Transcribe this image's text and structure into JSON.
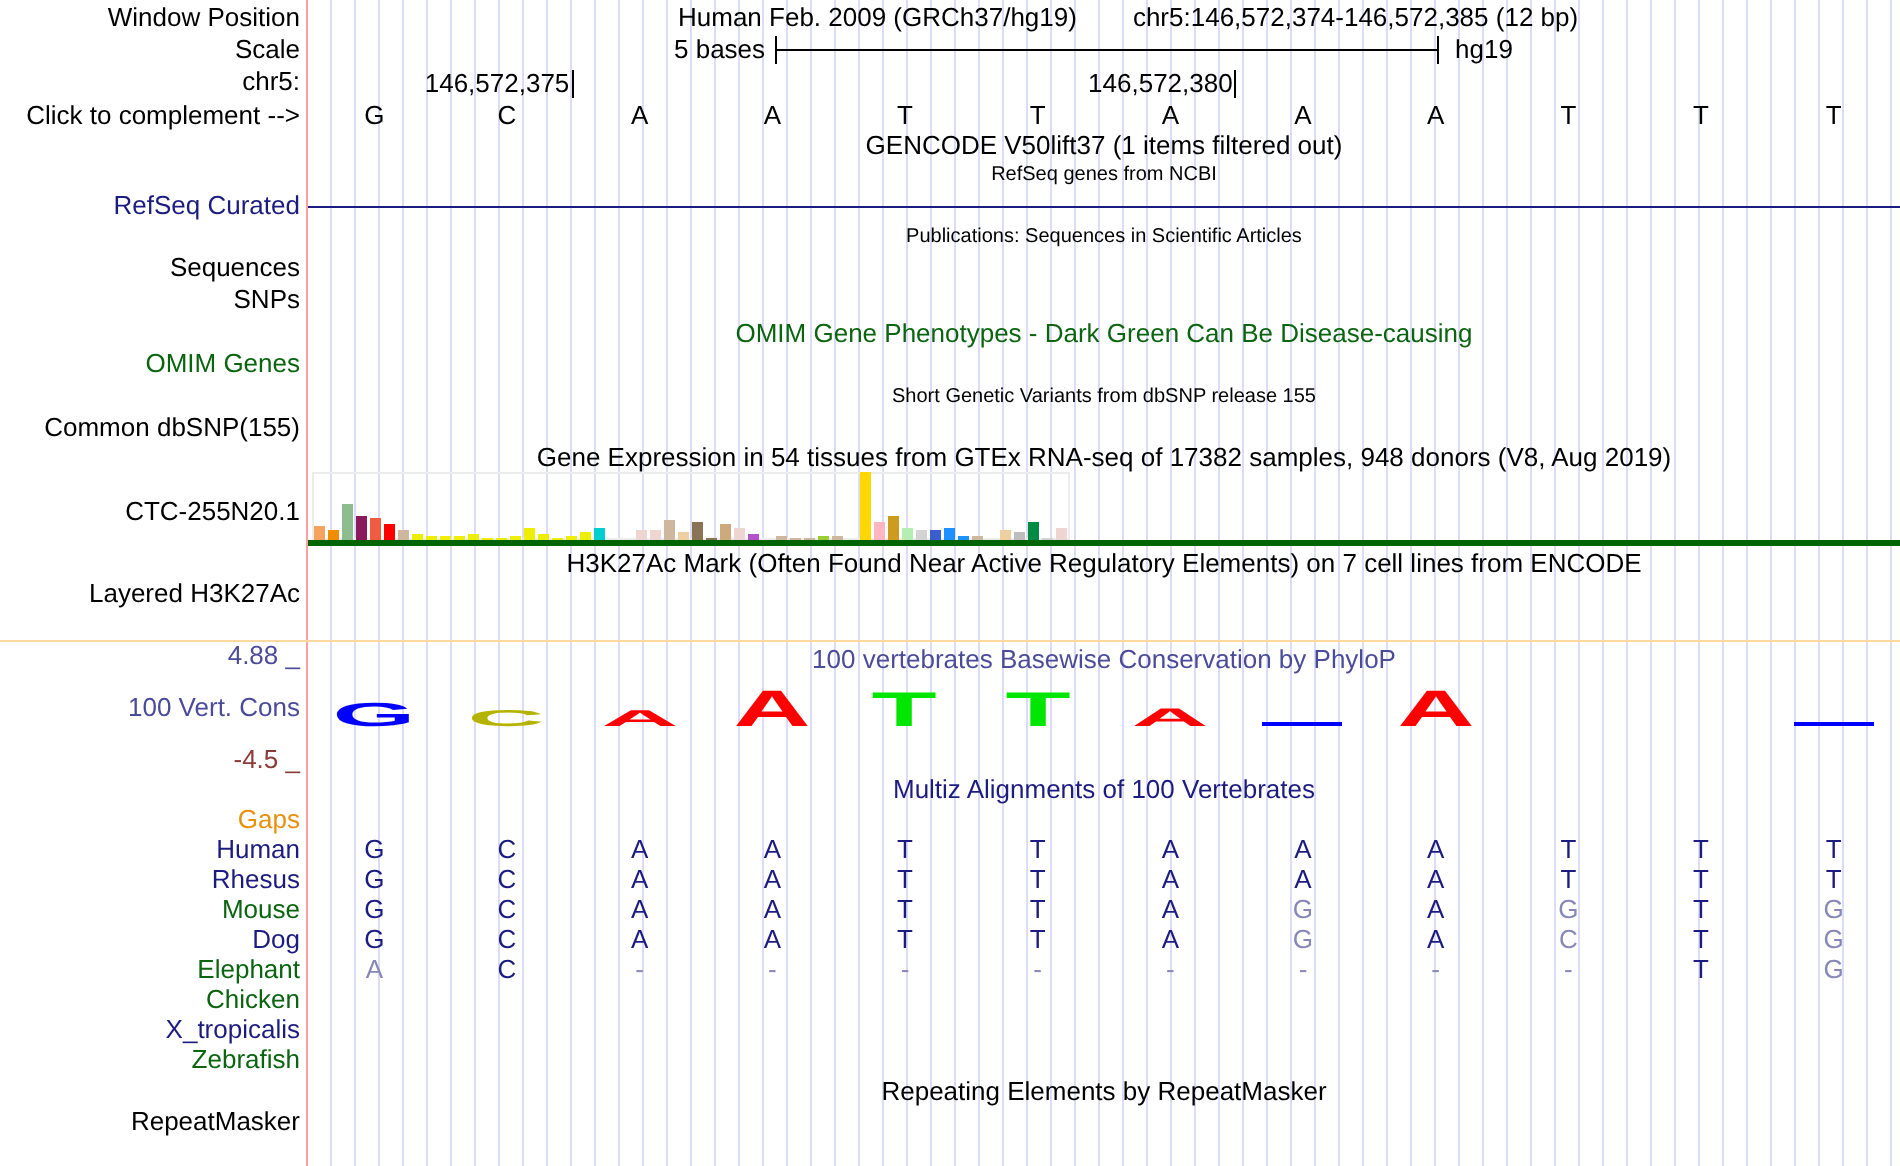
{
  "header": {
    "window_position_label": "Window Position",
    "assembly": "Human Feb. 2009 (GRCh37/hg19)",
    "position": "chr5:146,572,374-146,572,385 (12 bp)",
    "scale_label": "Scale",
    "scale_text": "5 bases",
    "scale_db": "hg19",
    "chrom_label": "chr5:",
    "complement_label": "Click to complement -->"
  },
  "bases": [
    {
      "base": "G"
    },
    {
      "base": "C",
      "tick": "146,572,375"
    },
    {
      "base": "A"
    },
    {
      "base": "A"
    },
    {
      "base": "T"
    },
    {
      "base": "T"
    },
    {
      "base": "A",
      "tick": "146,572,380"
    },
    {
      "base": "A"
    },
    {
      "base": "A"
    },
    {
      "base": "T"
    },
    {
      "base": "T"
    },
    {
      "base": "T"
    }
  ],
  "tracks": [
    {
      "kind": "title",
      "title": "GENCODE V50lift37 (1 items filtered out)"
    },
    {
      "kind": "line",
      "title": "RefSeq genes from NCBI",
      "labels": [
        "RefSeq Curated"
      ],
      "color": "#1c1c80"
    },
    {
      "kind": "note",
      "title": "Publications: Sequences in Scientific Articles",
      "labels": [
        "Sequences",
        "SNPs"
      ]
    },
    {
      "kind": "text",
      "title": "OMIM Gene Phenotypes - Dark Green Can Be Disease-causing",
      "labels": [
        "OMIM Genes"
      ],
      "color": "#0b6410"
    },
    {
      "kind": "note",
      "title": "Short Genetic Variants from dbSNP release 155",
      "labels": [
        "Common dbSNP(155)"
      ]
    },
    {
      "kind": "expression",
      "title": "Gene Expression in 54 tissues from GTEx RNA-seq of 17382 samples, 948 donors (V8, Aug 2019)",
      "labels": [
        "CTC-255N20.1"
      ]
    },
    {
      "kind": "signal",
      "title": "H3K27Ac Mark (Often Found Near Active Regulatory Elements) on 7 cell lines from ENCODE",
      "labels": [
        "Layered H3K27Ac"
      ]
    },
    {
      "kind": "conservation",
      "title": "100 vertebrates Basewise Conservation by PhyloP",
      "labels": [
        "100 Vert. Cons"
      ],
      "color": "#4b4b9a",
      "max": "4.88 _",
      "min": "-4.5 _",
      "logo": [
        {
          "kind": "letter",
          "letter": "G",
          "color": "#0000ff"
        },
        {
          "kind": "letter",
          "letter": "C",
          "color": "#b4b400"
        },
        {
          "kind": "letter",
          "letter": "A",
          "color": "#ff0000"
        },
        {
          "kind": "letter",
          "letter": "A",
          "color": "#ff0000"
        },
        {
          "kind": "letter",
          "letter": "T",
          "color": "#00e600"
        },
        {
          "kind": "letter",
          "letter": "T",
          "color": "#00e600"
        },
        {
          "kind": "letter",
          "letter": "A",
          "color": "#ff0000"
        },
        {
          "kind": "dash",
          "color": "#0000ff"
        },
        {
          "kind": "letter",
          "letter": "A",
          "color": "#ff0000"
        },
        {
          "kind": "blank"
        },
        {
          "kind": "blank"
        },
        {
          "kind": "dash",
          "color": "#0000ff"
        }
      ]
    },
    {
      "kind": "alignment",
      "title": "Multiz Alignments of 100 Vertebrates",
      "color": "#1c1c80",
      "gaps_label": "Gaps",
      "species": [
        {
          "name": "Human",
          "color": "#1c1c80",
          "cells": [
            {
              "base": "G",
              "match": true
            },
            {
              "base": "C",
              "match": true
            },
            {
              "base": "A",
              "match": true
            },
            {
              "base": "A",
              "match": true
            },
            {
              "base": "T",
              "match": true
            },
            {
              "base": "T",
              "match": true
            },
            {
              "base": "A",
              "match": true
            },
            {
              "base": "A",
              "match": true
            },
            {
              "base": "A",
              "match": true
            },
            {
              "base": "T",
              "match": true
            },
            {
              "base": "T",
              "match": true
            },
            {
              "base": "T",
              "match": true
            }
          ]
        },
        {
          "name": "Rhesus",
          "color": "#1c1c80",
          "cells": [
            {
              "base": "G",
              "match": true
            },
            {
              "base": "C",
              "match": true
            },
            {
              "base": "A",
              "match": true
            },
            {
              "base": "A",
              "match": true
            },
            {
              "base": "T",
              "match": true
            },
            {
              "base": "T",
              "match": true
            },
            {
              "base": "A",
              "match": true
            },
            {
              "base": "A",
              "match": true
            },
            {
              "base": "A",
              "match": true
            },
            {
              "base": "T",
              "match": true
            },
            {
              "base": "T",
              "match": true
            },
            {
              "base": "T",
              "match": true
            }
          ]
        },
        {
          "name": "Mouse",
          "color": "#0b6410",
          "cells": [
            {
              "base": "G",
              "match": true
            },
            {
              "base": "C",
              "match": true
            },
            {
              "base": "A",
              "match": true
            },
            {
              "base": "A",
              "match": true
            },
            {
              "base": "T",
              "match": true
            },
            {
              "base": "T",
              "match": true
            },
            {
              "base": "A",
              "match": true
            },
            {
              "base": "G",
              "match": false
            },
            {
              "base": "A",
              "match": true
            },
            {
              "base": "G",
              "match": false
            },
            {
              "base": "T",
              "match": true
            },
            {
              "base": "G",
              "match": false
            }
          ]
        },
        {
          "name": "Dog",
          "color": "#1c1c80",
          "cells": [
            {
              "base": "G",
              "match": true
            },
            {
              "base": "C",
              "match": true
            },
            {
              "base": "A",
              "match": true
            },
            {
              "base": "A",
              "match": true
            },
            {
              "base": "T",
              "match": true
            },
            {
              "base": "T",
              "match": true
            },
            {
              "base": "A",
              "match": true
            },
            {
              "base": "G",
              "match": false
            },
            {
              "base": "A",
              "match": true
            },
            {
              "base": "C",
              "match": false
            },
            {
              "base": "T",
              "match": true
            },
            {
              "base": "G",
              "match": false
            }
          ]
        },
        {
          "name": "Elephant",
          "color": "#0b6410",
          "cells": [
            {
              "base": "A",
              "match": false
            },
            {
              "base": "C",
              "match": true
            },
            {
              "base": "-",
              "match": false
            },
            {
              "base": "-",
              "match": false
            },
            {
              "base": "-",
              "match": false
            },
            {
              "base": "-",
              "match": false
            },
            {
              "base": "-",
              "match": false
            },
            {
              "base": "-",
              "match": false
            },
            {
              "base": "-",
              "match": false
            },
            {
              "base": "-",
              "match": false
            },
            {
              "base": "T",
              "match": true
            },
            {
              "base": "G",
              "match": false
            }
          ]
        },
        {
          "name": "Chicken",
          "color": "#0b6410"
        },
        {
          "name": "X_tropicalis",
          "color": "#1c1c80"
        },
        {
          "name": "Zebrafish",
          "color": "#0b6410"
        }
      ]
    },
    {
      "kind": "text",
      "title": "Repeating Elements by RepeatMasker",
      "labels": [
        "RepeatMasker"
      ]
    }
  ]
}
